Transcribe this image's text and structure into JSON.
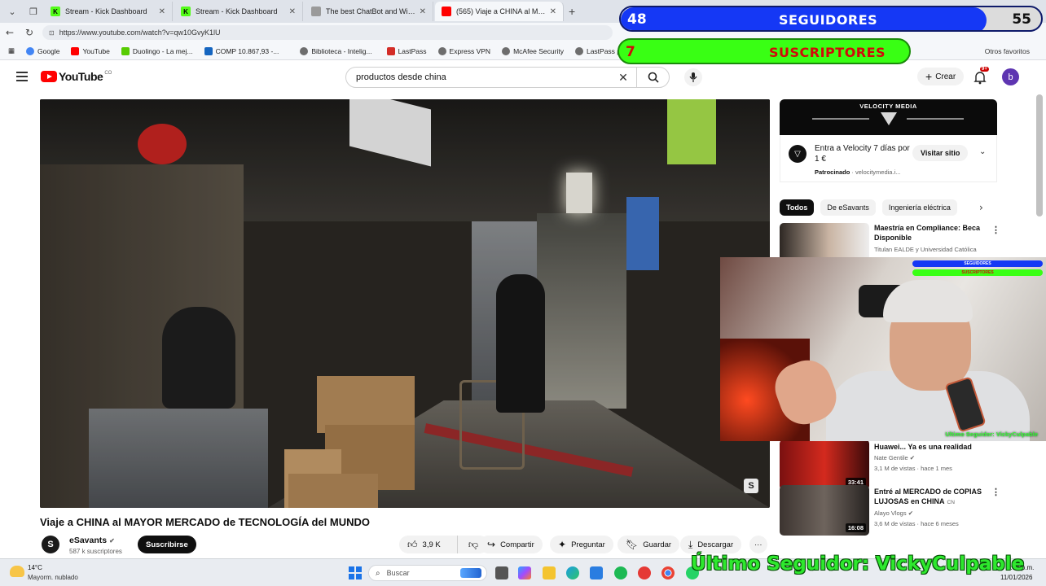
{
  "browser": {
    "tabs": [
      {
        "title": "Stream - Kick Dashboard",
        "favicon_color": "#53fc18",
        "favicon_letter": "K",
        "active": false
      },
      {
        "title": "Stream - Kick Dashboard",
        "favicon_color": "#53fc18",
        "favicon_letter": "K",
        "active": false
      },
      {
        "title": "The best ChatBot and Widgets for",
        "favicon_color": "#9a9a9a",
        "favicon_letter": "",
        "active": false
      },
      {
        "title": "(565) Viaje a CHINA al MAYOR ME",
        "favicon_color": "#ff0000",
        "favicon_letter": "",
        "active": true
      }
    ],
    "url": "https://www.youtube.com/watch?v=qw10GvyK1lU",
    "bookmarks": [
      {
        "label": "Google",
        "color": "#4285f4"
      },
      {
        "label": "YouTube",
        "color": "#ff0000"
      },
      {
        "label": "Duolingo - La mej...",
        "color": "#58cc02"
      },
      {
        "label": "COMP 10.867,93 -...",
        "color": "#1565c0"
      },
      {
        "label": "Biblioteca - Intelig...",
        "color": "#6d6d6d"
      },
      {
        "label": "LastPass",
        "color": "#d32d27"
      },
      {
        "label": "Express VPN",
        "color": "#6d6d6d"
      },
      {
        "label": "McAfee Security",
        "color": "#6d6d6d"
      },
      {
        "label": "LastPass passwor",
        "color": "#6d6d6d"
      }
    ],
    "other_favorites": "Otros favoritos"
  },
  "youtube": {
    "logo_text": "YouTube",
    "logo_region": "CO",
    "search_value": "productos desde china",
    "create_label": "Crear",
    "notification_count": "9+",
    "avatar_letter": "b",
    "video_title": "Viaje a CHINA al MAYOR MERCADO de TECNOLOGÍA del MUNDO",
    "channel_name": "eSavants",
    "channel_subs": "587 k suscriptores",
    "subscribe_label": "Suscribirse",
    "actions": {
      "likes": "3,9 K",
      "share": "Compartir",
      "ask": "Preguntar",
      "save": "Guardar",
      "download": "Descargar",
      "more": "···"
    },
    "ad": {
      "banner_label": "VELOCITY MEDIA",
      "text": "Entra a Velocity 7 días por 1 €",
      "sponsor_label": "Patrocinado",
      "sponsor_domain": "velocitymedia.i...",
      "visit_label": "Visitar sitio"
    },
    "chips": [
      "Todos",
      "De eSavants",
      "Ingeniería eléctrica"
    ],
    "recommendations": [
      {
        "title": "Maestría en Compliance: Beca Disponible",
        "channel": "Titulan EALDE y Universidad Católica",
        "meta": "",
        "duration": "",
        "cn": false
      },
      {
        "title": "Huawei... Ya es una realidad",
        "channel": "Nate Gentile",
        "meta": "3,1 M de vistas · hace 1 mes",
        "duration": "33:41",
        "cn": false
      },
      {
        "title": "Entré al MERCADO de COPIAS LUJOSAS en CHINA",
        "channel": "Alayo Vlogs",
        "meta": "3,6 M de vistas · hace 6 meses",
        "duration": "16:08",
        "cn": true
      }
    ],
    "cn_badge": "CN"
  },
  "overlay": {
    "followers": {
      "label": "SEGUIDORES",
      "current": "48",
      "goal": "55",
      "progress": 0.87,
      "color": "#1538f5"
    },
    "subscribers": {
      "label": "SUSCRIPTORES",
      "current": "7",
      "progress": 0.0,
      "color": "#39ff14",
      "text_color": "#d10a0a"
    },
    "last_follower": "Último Seguidor: VickyCulpable",
    "cam_caption": "Ultimo Seguidor: VickyCulpable",
    "mini_followers": "SEGUIDORES",
    "mini_subs": "SUSCRIPTORES"
  },
  "taskbar": {
    "temperature": "14°C",
    "weather": "Mayorm. nublado",
    "search_placeholder": "Buscar",
    "time": "9:54 p.m.",
    "date": "11/01/2026"
  }
}
